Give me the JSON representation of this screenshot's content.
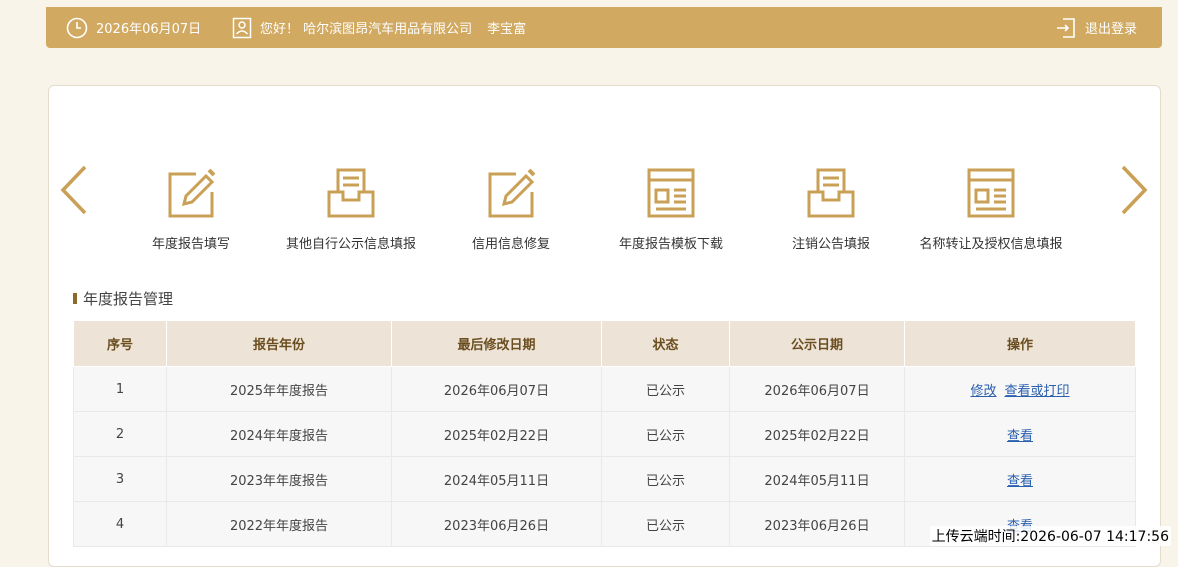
{
  "header": {
    "date": "2026年06月07日",
    "greeting": "您好！ 哈尔滨图昂汽车用品有限公司",
    "user_name": "李宝富",
    "logout_label": "退出登录"
  },
  "nav": {
    "items": [
      {
        "label": "年度报告填写",
        "icon": "edit-icon"
      },
      {
        "label": "其他自行公示信息填报",
        "icon": "inbox-icon"
      },
      {
        "label": "信用信息修复",
        "icon": "edit-icon"
      },
      {
        "label": "年度报告模板下载",
        "icon": "template-icon"
      },
      {
        "label": "注销公告填报",
        "icon": "inbox-icon"
      },
      {
        "label": "名称转让及授权信息填报",
        "icon": "template-icon"
      }
    ]
  },
  "section": {
    "title": "年度报告管理"
  },
  "table": {
    "headers": [
      "序号",
      "报告年份",
      "最后修改日期",
      "状态",
      "公示日期",
      "操作"
    ],
    "rows": [
      {
        "no": "1",
        "year": "2025年年度报告",
        "modified": "2026年06月07日",
        "status": "已公示",
        "published": "2026年06月07日",
        "actions": [
          "修改",
          "查看或打印"
        ]
      },
      {
        "no": "2",
        "year": "2024年年度报告",
        "modified": "2025年02月22日",
        "status": "已公示",
        "published": "2025年02月22日",
        "actions": [
          "查看"
        ]
      },
      {
        "no": "3",
        "year": "2023年年度报告",
        "modified": "2024年05月11日",
        "status": "已公示",
        "published": "2024年05月11日",
        "actions": [
          "查看"
        ]
      },
      {
        "no": "4",
        "year": "2022年年度报告",
        "modified": "2023年06月26日",
        "status": "已公示",
        "published": "2023年06月26日",
        "actions": [
          "查看"
        ]
      }
    ]
  },
  "footer": {
    "upload_time": "上传云端时间:2026-06-07 14:17:56"
  },
  "colors": {
    "accent": "#d1a960",
    "header_text": "#6b4e20",
    "link": "#2a5fae"
  }
}
